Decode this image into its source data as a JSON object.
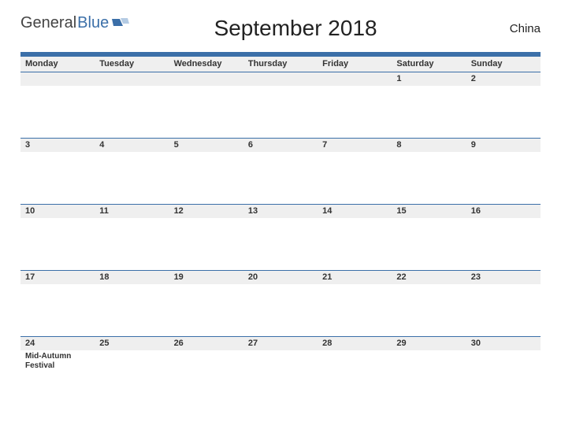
{
  "brand": {
    "part1": "General",
    "part2": "Blue"
  },
  "title": "September 2018",
  "country": "China",
  "day_headers": [
    "Monday",
    "Tuesday",
    "Wednesday",
    "Thursday",
    "Friday",
    "Saturday",
    "Sunday"
  ],
  "weeks": [
    {
      "days": [
        {
          "num": "",
          "event": ""
        },
        {
          "num": "",
          "event": ""
        },
        {
          "num": "",
          "event": ""
        },
        {
          "num": "",
          "event": ""
        },
        {
          "num": "",
          "event": ""
        },
        {
          "num": "1",
          "event": ""
        },
        {
          "num": "2",
          "event": ""
        }
      ]
    },
    {
      "days": [
        {
          "num": "3",
          "event": ""
        },
        {
          "num": "4",
          "event": ""
        },
        {
          "num": "5",
          "event": ""
        },
        {
          "num": "6",
          "event": ""
        },
        {
          "num": "7",
          "event": ""
        },
        {
          "num": "8",
          "event": ""
        },
        {
          "num": "9",
          "event": ""
        }
      ]
    },
    {
      "days": [
        {
          "num": "10",
          "event": ""
        },
        {
          "num": "11",
          "event": ""
        },
        {
          "num": "12",
          "event": ""
        },
        {
          "num": "13",
          "event": ""
        },
        {
          "num": "14",
          "event": ""
        },
        {
          "num": "15",
          "event": ""
        },
        {
          "num": "16",
          "event": ""
        }
      ]
    },
    {
      "days": [
        {
          "num": "17",
          "event": ""
        },
        {
          "num": "18",
          "event": ""
        },
        {
          "num": "19",
          "event": ""
        },
        {
          "num": "20",
          "event": ""
        },
        {
          "num": "21",
          "event": ""
        },
        {
          "num": "22",
          "event": ""
        },
        {
          "num": "23",
          "event": ""
        }
      ]
    },
    {
      "days": [
        {
          "num": "24",
          "event": "Mid-Autumn Festival"
        },
        {
          "num": "25",
          "event": ""
        },
        {
          "num": "26",
          "event": ""
        },
        {
          "num": "27",
          "event": ""
        },
        {
          "num": "28",
          "event": ""
        },
        {
          "num": "29",
          "event": ""
        },
        {
          "num": "30",
          "event": ""
        }
      ]
    }
  ]
}
